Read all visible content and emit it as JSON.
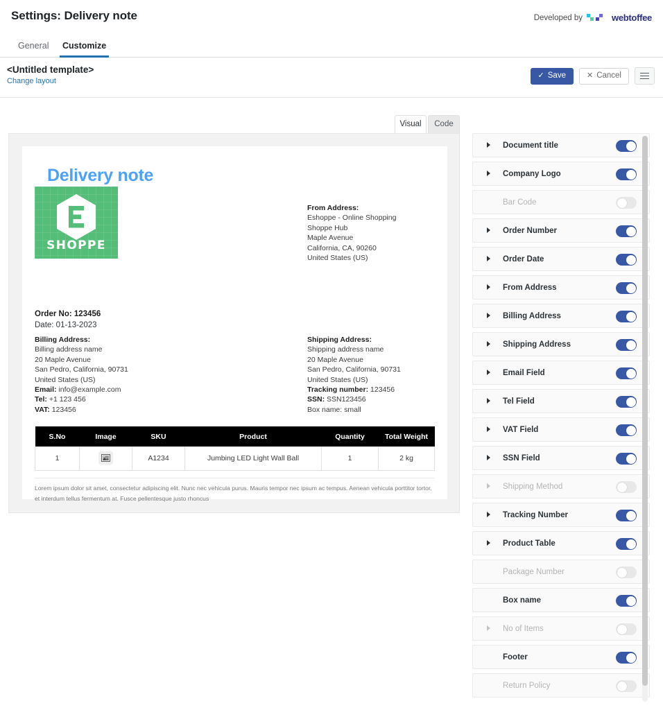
{
  "header": {
    "title": "Settings: Delivery note",
    "developed_by_label": "Developed by",
    "brand_name": "webtoffee"
  },
  "tabs": [
    {
      "label": "General",
      "active": false
    },
    {
      "label": "Customize",
      "active": true
    }
  ],
  "template_bar": {
    "template_name": "<Untitled template>",
    "change_layout_link": "Change layout",
    "save_label": "Save",
    "save_icon": "check-icon",
    "cancel_label": "Cancel",
    "cancel_icon": "close-icon",
    "menu_icon": "hamburger-icon"
  },
  "editor_tabs": [
    {
      "label": "Visual",
      "active": true
    },
    {
      "label": "Code",
      "active": false
    }
  ],
  "document": {
    "title": "Delivery note",
    "logo": {
      "word": "SHOPPE",
      "letter": "E",
      "bg_color": "#54bd77"
    },
    "from_address": {
      "heading": "From Address:",
      "lines": [
        "Eshoppe - Online Shopping",
        "Shoppe Hub",
        "Maple Avenue",
        "California, CA, 90260",
        "United States (US)"
      ]
    },
    "order": {
      "number_label": "Order No: 123456",
      "date_label": "Date: 01-13-2023"
    },
    "billing_address": {
      "heading": "Billing Address:",
      "lines": [
        "Billing address name",
        "20 Maple Avenue",
        "San Pedro, California, 90731",
        "United States (US)"
      ]
    },
    "shipping_address": {
      "heading": "Shipping Address:",
      "lines": [
        "Shipping address name",
        "20 Maple Avenue",
        "San Pedro, California, 90731",
        "United States (US)"
      ]
    },
    "contact": {
      "email_label": "Email:",
      "email_value": "info@example.com",
      "tel_label": "Tel:",
      "tel_value": "+1 123 456",
      "vat_label": "VAT:",
      "vat_value": "123456"
    },
    "tracking": {
      "tracking_label": "Tracking number:",
      "tracking_value": "123456",
      "ssn_label": "SSN:",
      "ssn_value": "SSN123456",
      "box_label": "Box name:",
      "box_value": "small"
    },
    "product_table": {
      "columns": [
        "S.No",
        "Image",
        "SKU",
        "Product",
        "Quantity",
        "Total Weight"
      ],
      "rows": [
        {
          "sno": "1",
          "image": "image-placeholder-icon",
          "sku": "A1234",
          "product": "Jumbing LED Light Wall Ball",
          "quantity": "1",
          "total_weight": "2 kg"
        }
      ]
    },
    "footer_note": "Lorem ipsum dolor sit amet, consectetur adipiscing elit. Nunc nec vehicula purus. Mauris tempor nec ipsum ac tempus. Aenean vehicula porttitor tortor, et interdum tellus fermentum at. Fusce pellentesque justo rhoncus"
  },
  "sidebar": {
    "items": [
      {
        "label": "Document title",
        "enabled": true,
        "expandable": true
      },
      {
        "label": "Company Logo",
        "enabled": true,
        "expandable": true
      },
      {
        "label": "Bar Code",
        "enabled": false,
        "expandable": false
      },
      {
        "label": "Order Number",
        "enabled": true,
        "expandable": true
      },
      {
        "label": "Order Date",
        "enabled": true,
        "expandable": true
      },
      {
        "label": "From Address",
        "enabled": true,
        "expandable": true
      },
      {
        "label": "Billing Address",
        "enabled": true,
        "expandable": true
      },
      {
        "label": "Shipping Address",
        "enabled": true,
        "expandable": true
      },
      {
        "label": "Email Field",
        "enabled": true,
        "expandable": true
      },
      {
        "label": "Tel Field",
        "enabled": true,
        "expandable": true
      },
      {
        "label": "VAT Field",
        "enabled": true,
        "expandable": true
      },
      {
        "label": "SSN Field",
        "enabled": true,
        "expandable": true
      },
      {
        "label": "Shipping Method",
        "enabled": false,
        "expandable": true
      },
      {
        "label": "Tracking Number",
        "enabled": true,
        "expandable": true
      },
      {
        "label": "Product Table",
        "enabled": true,
        "expandable": true
      },
      {
        "label": "Package Number",
        "enabled": false,
        "expandable": false
      },
      {
        "label": "Box name",
        "enabled": true,
        "expandable": false
      },
      {
        "label": "No of Items",
        "enabled": false,
        "expandable": true
      },
      {
        "label": "Footer",
        "enabled": true,
        "expandable": false
      },
      {
        "label": "Return Policy",
        "enabled": false,
        "expandable": false
      }
    ]
  },
  "colors": {
    "accent_blue": "#3858a6",
    "link_blue": "#2271b1",
    "doc_title_blue": "#4da2f7",
    "logo_green": "#54bd77",
    "table_header_bg": "#000000"
  }
}
